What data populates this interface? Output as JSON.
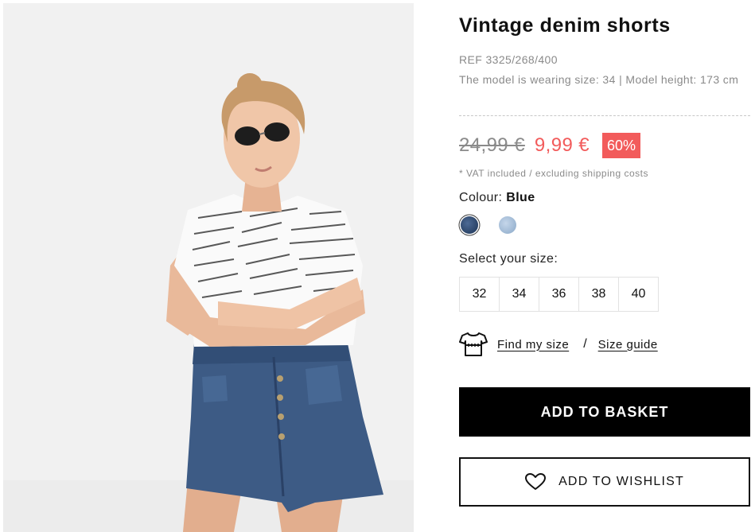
{
  "product": {
    "title": "Vintage denim shorts",
    "ref": "REF 3325/268/400",
    "model_info": "The model is wearing size: 34 | Model height: 173 cm",
    "image_icon": "product-photo",
    "shirt_print": [
      "Berlin",
      "Milan",
      "Hong Kong",
      "Tokyo",
      "Kiev",
      "Roma",
      "Paris",
      "Los Angeles",
      "New-York",
      "Dubai"
    ]
  },
  "price": {
    "old": "24,99 €",
    "new": "9,99 €",
    "discount": "60%",
    "vat_note": "* VAT included / excluding shipping costs"
  },
  "colour": {
    "label": "Colour:",
    "value": "Blue",
    "swatches": [
      {
        "name": "dark-blue",
        "hex": "#2b4468",
        "selected": true
      },
      {
        "name": "light-blue",
        "hex": "#9cb6d2",
        "selected": false
      }
    ]
  },
  "size": {
    "label": "Select your size:",
    "options": [
      "32",
      "34",
      "36",
      "38",
      "40"
    ]
  },
  "links": {
    "find_my_size": "Find my size",
    "separator": "/",
    "size_guide": "Size guide",
    "icon": "tshirt-icon"
  },
  "actions": {
    "add_to_basket": "ADD TO BASKET",
    "add_to_wishlist": "ADD TO WISHLIST",
    "wishlist_icon": "heart-icon"
  },
  "colors": {
    "sale_red": "#f25b5b",
    "muted_text": "#8a8a8a",
    "primary_button": "#000000"
  }
}
